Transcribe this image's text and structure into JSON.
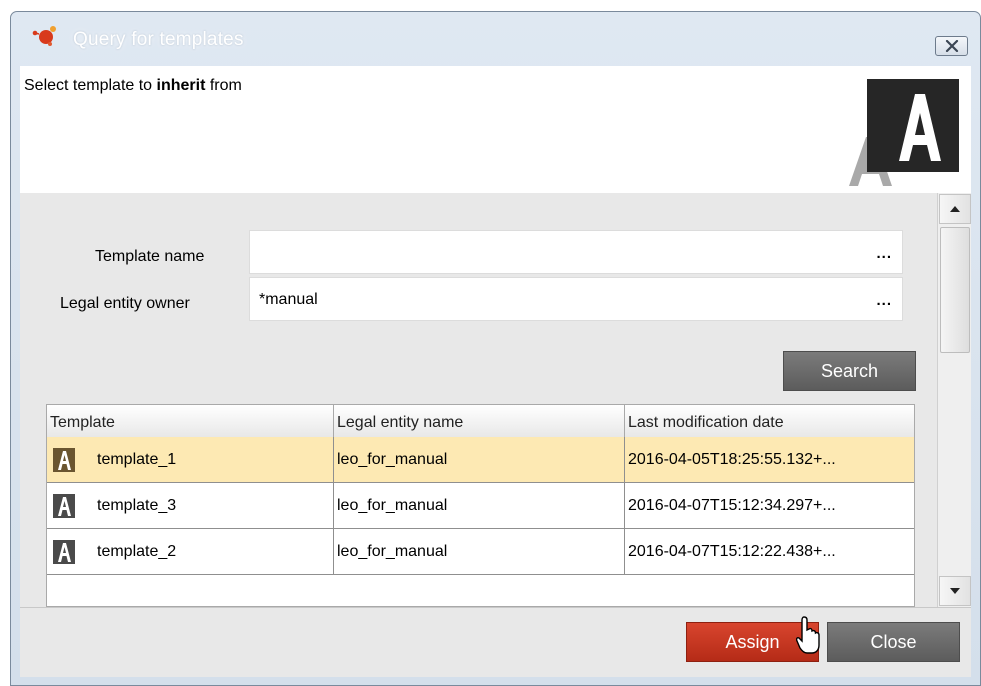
{
  "window": {
    "title": "Query for templates",
    "close_icon": "close-icon"
  },
  "header": {
    "instruction_prefix": "Select template to ",
    "instruction_emphasis": "inherit",
    "instruction_suffix": " from",
    "logo_icon": "app-logo-icon"
  },
  "form": {
    "template_name_label": "Template name",
    "template_name_value": "",
    "legal_entity_owner_label": "Legal entity owner",
    "legal_entity_owner_value": "*manual",
    "ellipsis": "..."
  },
  "search_button": "Search",
  "grid": {
    "columns": [
      "Template",
      "Legal entity name",
      "Last modification date"
    ],
    "rows": [
      {
        "template": "template_1",
        "legal_entity": "leo_for_manual",
        "modified": "2016-04-05T18:25:55.132+...",
        "selected": true
      },
      {
        "template": "template_3",
        "legal_entity": "leo_for_manual",
        "modified": "2016-04-07T15:12:34.297+...",
        "selected": false
      },
      {
        "template": "template_2",
        "legal_entity": "leo_for_manual",
        "modified": "2016-04-07T15:12:22.438+...",
        "selected": false
      }
    ]
  },
  "buttons": {
    "assign": "Assign",
    "close": "Close"
  },
  "colors": {
    "accent_red": "#c2341f",
    "button_gray": "#6b6b6b",
    "selection": "#fde9b3"
  }
}
